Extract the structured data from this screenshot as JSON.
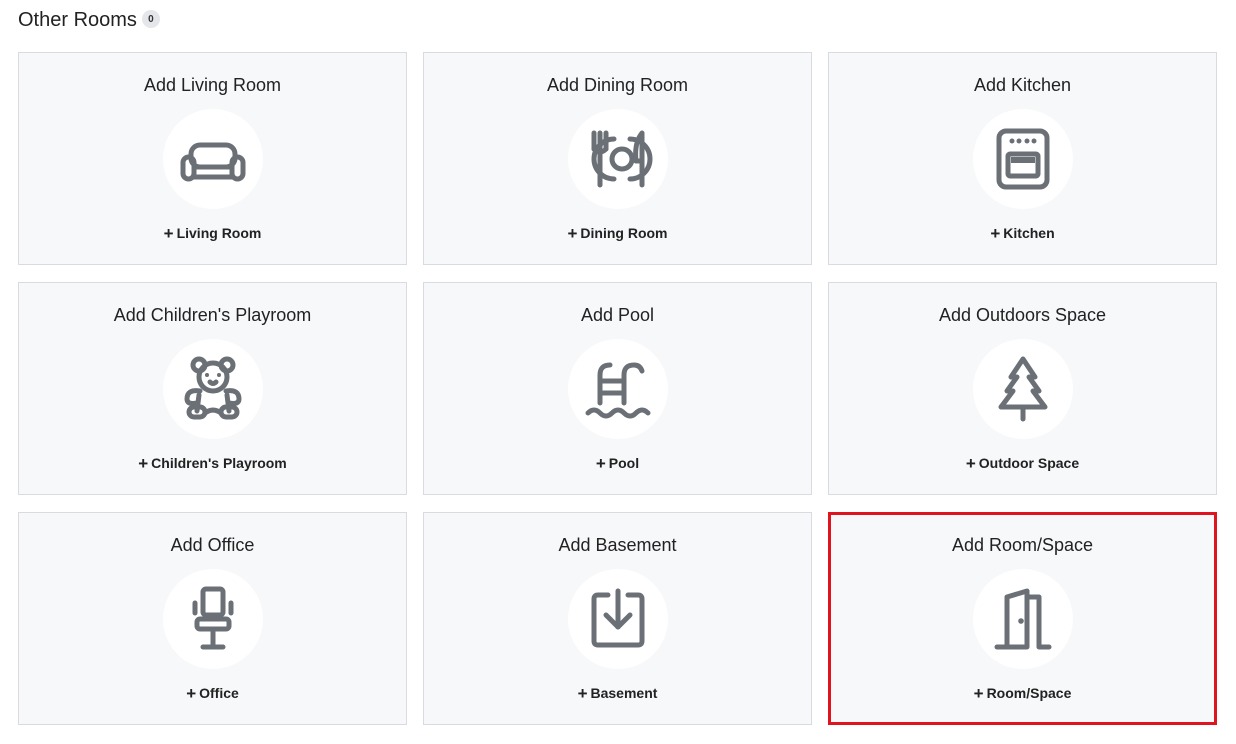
{
  "section": {
    "title": "Other Rooms",
    "count": "0"
  },
  "cards": [
    {
      "title": "Add Living Room",
      "link": "Living Room",
      "icon": "sofa-icon"
    },
    {
      "title": "Add Dining Room",
      "link": "Dining Room",
      "icon": "plate-cutlery-icon"
    },
    {
      "title": "Add Kitchen",
      "link": "Kitchen",
      "icon": "oven-icon"
    },
    {
      "title": "Add Children's Playroom",
      "link": "Children's Playroom",
      "icon": "teddy-bear-icon"
    },
    {
      "title": "Add Pool",
      "link": "Pool",
      "icon": "pool-ladder-icon"
    },
    {
      "title": "Add Outdoors Space",
      "link": "Outdoor Space",
      "icon": "pine-tree-icon"
    },
    {
      "title": "Add Office",
      "link": "Office",
      "icon": "office-chair-icon"
    },
    {
      "title": "Add Basement",
      "link": "Basement",
      "icon": "download-box-icon"
    },
    {
      "title": "Add Room/Space",
      "link": "Room/Space",
      "icon": "door-icon"
    }
  ],
  "plus_symbol": "+",
  "colors": {
    "icon": "#6b6f76",
    "card_background": "#f7f8fa",
    "selection_border": "#e0141e"
  }
}
